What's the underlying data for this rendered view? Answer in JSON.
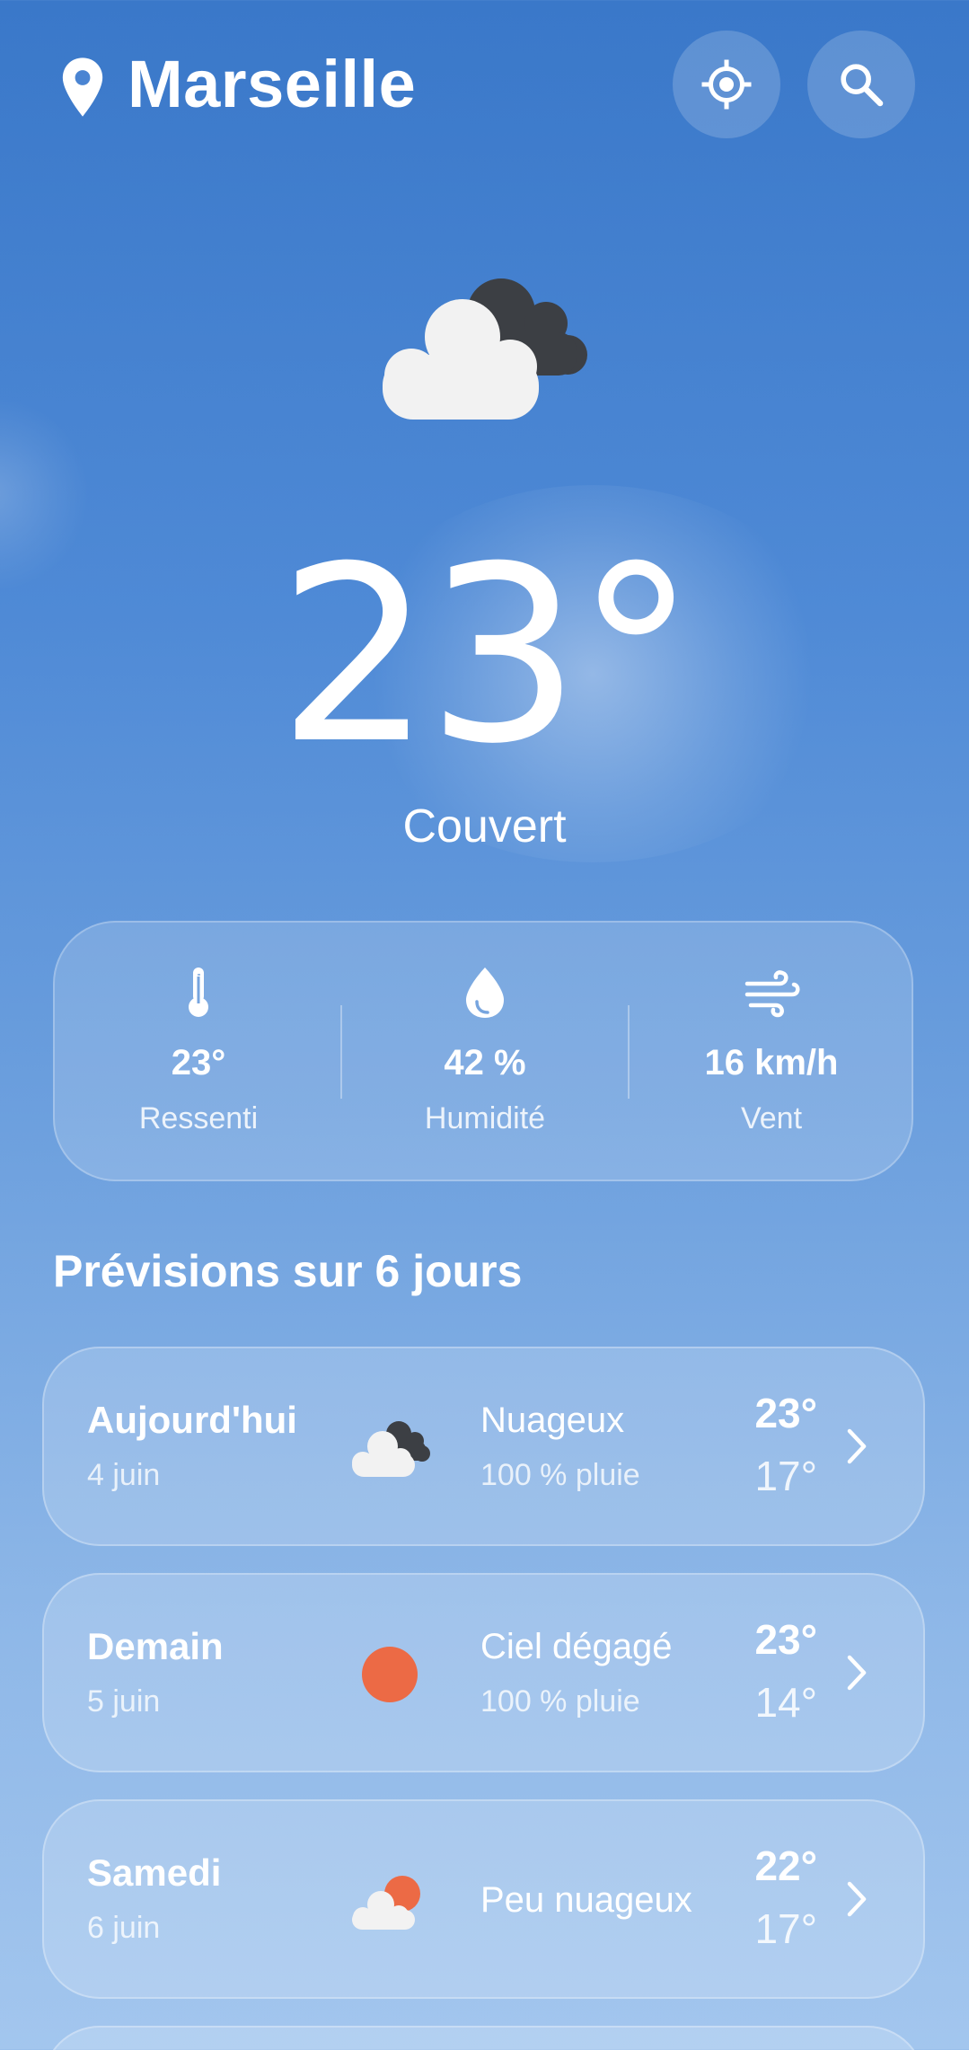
{
  "header": {
    "city": "Marseille"
  },
  "current": {
    "temperature": "23°",
    "condition": "Couvert"
  },
  "stats": [
    {
      "value": "23°",
      "label": "Ressenti",
      "icon": "thermometer-icon"
    },
    {
      "value": "42 %",
      "label": "Humidité",
      "icon": "droplet-icon"
    },
    {
      "value": "16 km/h",
      "label": "Vent",
      "icon": "wind-icon"
    }
  ],
  "forecast": {
    "title": "Prévisions sur 6 jours",
    "days": [
      {
        "day": "Aujourd'hui",
        "date": "4 juin",
        "condition": "Nuageux",
        "rain": "100 % pluie",
        "high": "23°",
        "low": "17°",
        "icon": "cloudy-icon"
      },
      {
        "day": "Demain",
        "date": "5 juin",
        "condition": "Ciel dégagé",
        "rain": "100 % pluie",
        "high": "23°",
        "low": "14°",
        "icon": "sun-icon"
      },
      {
        "day": "Samedi",
        "date": "6 juin",
        "condition": "Peu nuageux",
        "rain": "",
        "high": "22°",
        "low": "17°",
        "icon": "partly-cloudy-icon"
      }
    ]
  },
  "colors": {
    "sun": "#ec6a45",
    "dark_cloud": "#3c3f44",
    "light_cloud": "#f2f2f2"
  }
}
